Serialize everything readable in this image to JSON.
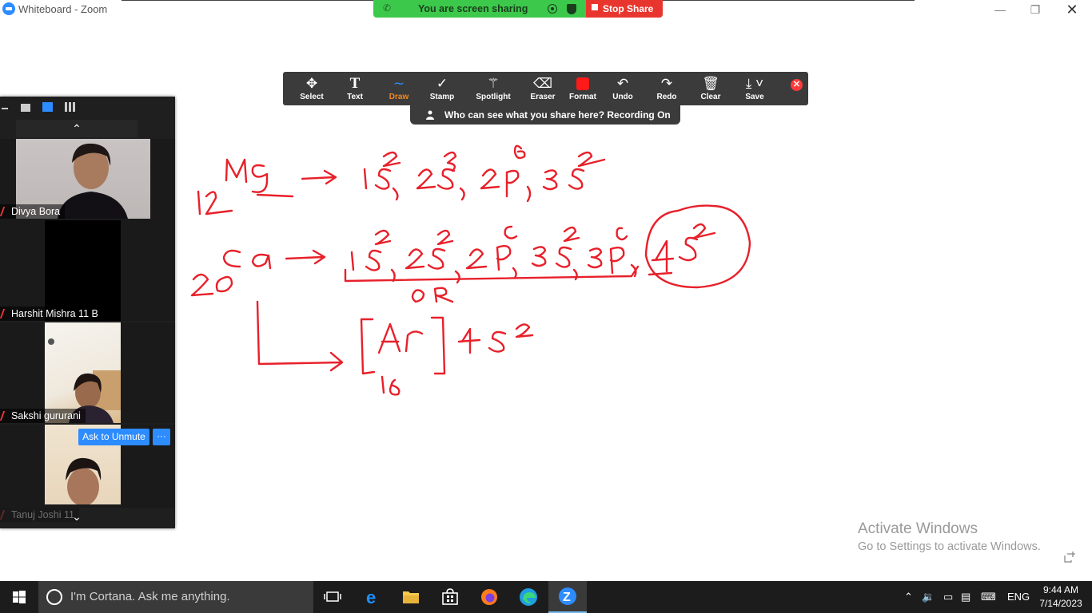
{
  "window": {
    "title": "Whiteboard - Zoom",
    "controls": {
      "minimize": "—",
      "restore": "❐",
      "close": "✕"
    }
  },
  "share_banner": {
    "label": "You are screen sharing",
    "stop_label": "Stop Share"
  },
  "toolbar": {
    "tools": [
      {
        "label": "Select",
        "icon": "move-icon"
      },
      {
        "label": "Text",
        "icon": "text-icon"
      },
      {
        "label": "Draw",
        "icon": "draw-icon",
        "active": true
      },
      {
        "label": "Stamp",
        "icon": "check-icon"
      },
      {
        "label": "Spotlight",
        "icon": "wand-icon"
      },
      {
        "label": "Eraser",
        "icon": "eraser-icon"
      },
      {
        "label": "Format",
        "icon": "format-icon"
      },
      {
        "label": "Undo",
        "icon": "undo-icon"
      },
      {
        "label": "Redo",
        "icon": "redo-icon"
      },
      {
        "label": "Clear",
        "icon": "trash-icon"
      },
      {
        "label": "Save",
        "icon": "save-icon"
      }
    ],
    "format_color": "#ff1a1a",
    "who_can_see": "Who can see what you share here? Recording On"
  },
  "participants": [
    {
      "name": "Divya Bora",
      "muted": true
    },
    {
      "name": "Harshit Mishra 11 B",
      "muted": true
    },
    {
      "name": "Sakshi gururani",
      "muted": true
    },
    {
      "name": "Tanuj Joshi 11",
      "muted": true
    }
  ],
  "ask_to_unmute": "Ask to Unmute",
  "more_options": "···",
  "watermark": {
    "line1": "Activate Windows",
    "line2": "Go to Settings to activate Windows."
  },
  "taskbar": {
    "search_placeholder": "I'm Cortana. Ask me anything.",
    "language": "ENG",
    "time": "9:44 AM",
    "date": "7/14/2023"
  },
  "colors": {
    "ink": "#e8202a",
    "zoom_blue": "#2d8cff",
    "share_green": "#3cc94b",
    "stop_red": "#e8362e"
  }
}
